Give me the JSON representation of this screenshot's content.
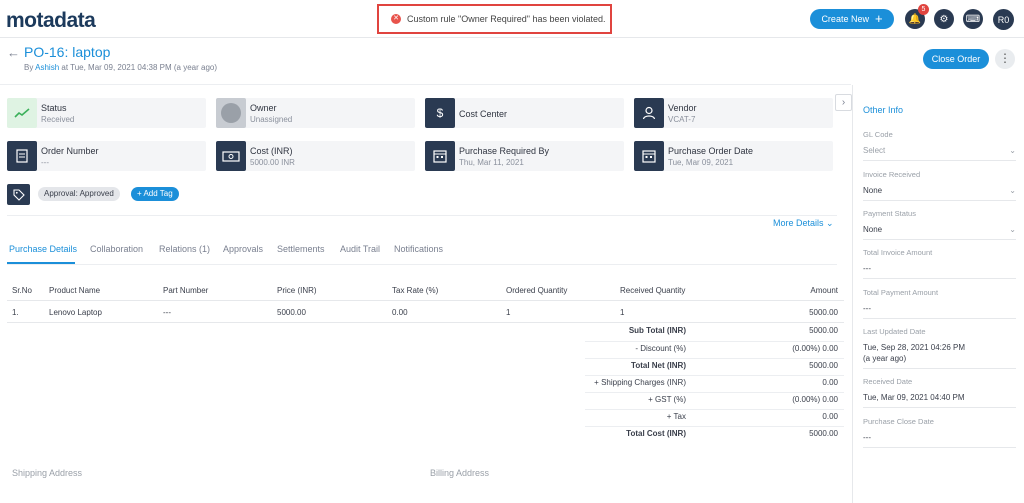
{
  "app": {
    "logo": "motadata",
    "toast_message": "Custom rule \"Owner Required\" has been violated.",
    "create_label": "Create New",
    "notification_count": "5",
    "avatar_initials": "R0"
  },
  "header": {
    "title": "PO-16: laptop",
    "by": "By",
    "author": "Ashish",
    "timestamp": "at Tue, Mar 09, 2021 04:38 PM (a year ago)",
    "close_label": "Close Order"
  },
  "cards": {
    "status_label": "Status",
    "status_value": "Received",
    "owner_label": "Owner",
    "owner_value": "Unassigned",
    "cost_center_label": "Cost Center",
    "vendor_label": "Vendor",
    "vendor_value": "VCAT-7",
    "order_number_label": "Order Number",
    "order_number_value": "---",
    "cost_label": "Cost (INR)",
    "cost_value": "5000.00 INR",
    "required_by_label": "Purchase Required By",
    "required_by_value": "Thu, Mar 11, 2021",
    "order_date_label": "Purchase Order Date",
    "order_date_value": "Tue, Mar 09, 2021"
  },
  "tags": {
    "approval": "Approval: Approved",
    "add_tag": "+ Add Tag"
  },
  "more_details": "More Details",
  "tabs": [
    "Purchase Details",
    "Collaboration",
    "Relations (1)",
    "Approvals",
    "Settlements",
    "Audit Trail",
    "Notifications"
  ],
  "table": {
    "headers": [
      "Sr.No",
      "Product Name",
      "Part Number",
      "Price (INR)",
      "Tax Rate (%)",
      "Ordered Quantity",
      "Received Quantity",
      "Amount"
    ],
    "rows": [
      [
        "1.",
        "Lenovo Laptop",
        "---",
        "5000.00",
        "0.00",
        "1",
        "1",
        "5000.00"
      ]
    ]
  },
  "summary": [
    {
      "label": "Sub Total (INR)",
      "value": "5000.00",
      "bold": true
    },
    {
      "label": "- Discount (%)",
      "value": "(0.00%) 0.00",
      "bold": false
    },
    {
      "label": "Total Net (INR)",
      "value": "5000.00",
      "bold": true
    },
    {
      "label": "+ Shipping Charges (INR)",
      "value": "0.00",
      "bold": false
    },
    {
      "label": "+ GST (%)",
      "value": "(0.00%) 0.00",
      "bold": false
    },
    {
      "label": "+ Tax",
      "value": "0.00",
      "bold": false
    },
    {
      "label": "Total Cost (INR)",
      "value": "5000.00",
      "bold": true
    }
  ],
  "addresses": {
    "shipping": "Shipping Address",
    "billing": "Billing Address"
  },
  "other_info": {
    "title": "Other Info",
    "fields": [
      {
        "label": "GL Code",
        "value": "Select",
        "dropdown": true,
        "muted": true
      },
      {
        "label": "Invoice Received",
        "value": "None",
        "dropdown": true,
        "muted": false
      },
      {
        "label": "Payment Status",
        "value": "None",
        "dropdown": true,
        "muted": false
      },
      {
        "label": "Total Invoice Amount",
        "value": "---",
        "dropdown": false,
        "muted": false
      },
      {
        "label": "Total Payment Amount",
        "value": "---",
        "dropdown": false,
        "muted": false
      },
      {
        "label": "Last Updated Date",
        "value": "Tue, Sep 28, 2021 04:26 PM",
        "value2": "(a year ago)",
        "dropdown": false,
        "muted": false
      },
      {
        "label": "Received Date",
        "value": "Tue, Mar 09, 2021 04:40 PM",
        "dropdown": false,
        "muted": false
      },
      {
        "label": "Purchase Close Date",
        "value": "---",
        "dropdown": false,
        "muted": false
      }
    ]
  },
  "colors": {
    "accent": "#1b8fd9",
    "dark_icon": "#2a3a52",
    "error": "#e0443f"
  }
}
